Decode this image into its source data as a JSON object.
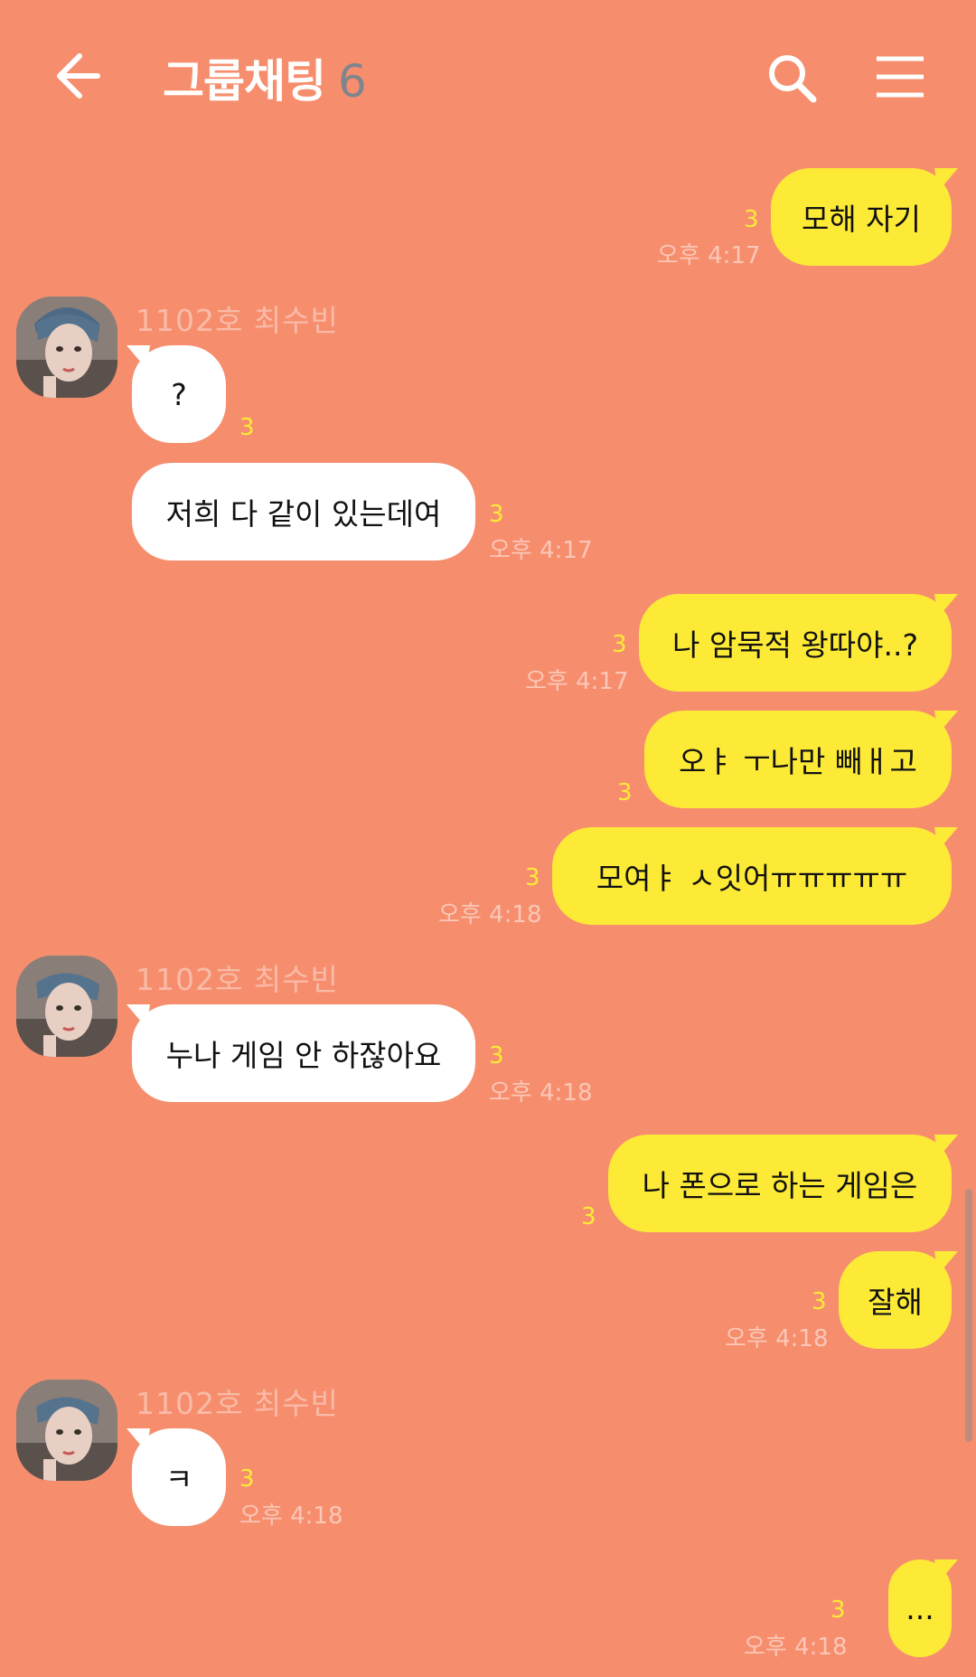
{
  "header": {
    "title": "그룹채팅",
    "member_count": "6",
    "back_icon": "arrow-left-icon",
    "search_icon": "search-icon",
    "menu_icon": "menu-icon"
  },
  "colors": {
    "background": "#F68E6E",
    "my_bubble": "#FDEA37",
    "other_bubble": "#FFFFFF",
    "unread": "#FDEA37"
  },
  "messages": [
    {
      "from": "me",
      "text": "모해 자기",
      "unread": "3",
      "time": "오후 4:17"
    },
    {
      "from": "other",
      "sender": "1102호 최수빈",
      "text": "?",
      "unread": "3",
      "time": ""
    },
    {
      "from": "other",
      "text": "저희 다 같이 있는데여",
      "unread": "3",
      "time": "오후 4:17"
    },
    {
      "from": "me",
      "text": "나 암묵적 왕따야..?",
      "unread": "3",
      "time": "오후 4:17"
    },
    {
      "from": "me",
      "text": "오ㅑ ㅜ나만 빼ㅐ고",
      "unread": "3",
      "time": ""
    },
    {
      "from": "me",
      "text": "모여ㅑ ㅅ잇어ㅠㅠㅠㅠㅠ",
      "unread": "3",
      "time": "오후 4:18"
    },
    {
      "from": "other",
      "sender": "1102호 최수빈",
      "text": "누나 게임 안 하잖아요",
      "unread": "3",
      "time": "오후 4:18"
    },
    {
      "from": "me",
      "text": "나 폰으로 하는 게임은",
      "unread": "3",
      "time": ""
    },
    {
      "from": "me",
      "text": "잘해",
      "unread": "3",
      "time": "오후 4:18"
    },
    {
      "from": "other",
      "sender": "1102호 최수빈",
      "text": "ㅋ",
      "unread": "3",
      "time": "오후 4:18"
    },
    {
      "from": "me",
      "text": "...",
      "unread": "3",
      "time": "오후 4:18"
    }
  ]
}
